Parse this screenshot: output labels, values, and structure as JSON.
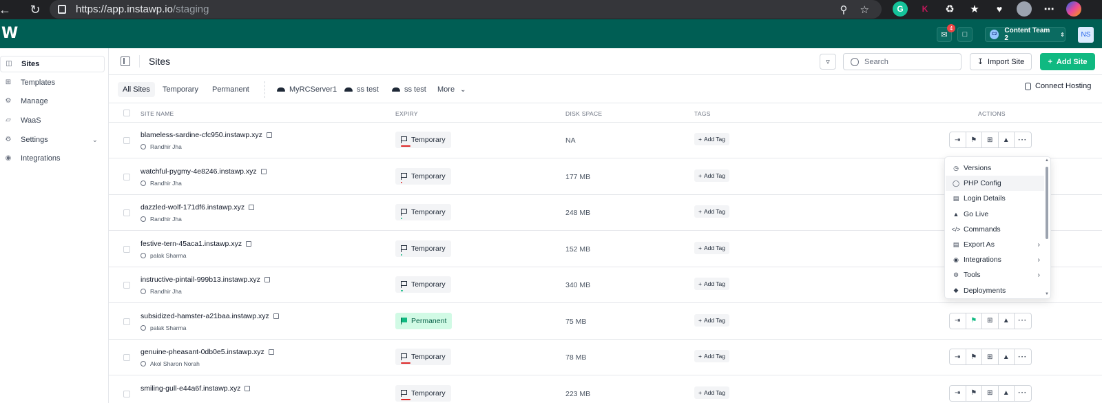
{
  "browser": {
    "url_host": "https://app.instawp.io",
    "url_path": "/staging",
    "extensions": [
      "G",
      "K"
    ]
  },
  "header": {
    "logo": "W",
    "notification_count": "4",
    "team_initials": "C2",
    "team_name": "Content Team 2",
    "user_initials": "NS"
  },
  "sidebar": {
    "items": [
      {
        "label": "Sites",
        "icon": "sites-icon"
      },
      {
        "label": "Templates",
        "icon": "templates-icon"
      },
      {
        "label": "Manage",
        "icon": "manage-icon"
      },
      {
        "label": "WaaS",
        "icon": "waas-icon"
      },
      {
        "label": "Settings",
        "icon": "settings-icon"
      },
      {
        "label": "Integrations",
        "icon": "integrations-icon"
      }
    ]
  },
  "page": {
    "title": "Sites",
    "search_placeholder": "Search",
    "import_label": "Import Site",
    "add_label": "Add Site"
  },
  "tabs": {
    "all": "All Sites",
    "temporary": "Temporary",
    "permanent": "Permanent",
    "servers": [
      "MyRCServer1",
      "ss test",
      "ss test"
    ],
    "more": "More",
    "connect_hosting": "Connect Hosting"
  },
  "table": {
    "headers": {
      "site_name": "SITE NAME",
      "expiry": "EXPIRY",
      "disk": "DISK SPACE",
      "tags": "TAGS",
      "actions": "ACTIONS"
    },
    "add_tag_label": "Add Tag",
    "rows": [
      {
        "name": "blameless-sardine-cfc950.instawp.xyz",
        "owner": "Randhir Jha",
        "expiry": "Temporary",
        "expiry_progress": 0.92,
        "expiry_color": "#dc2626",
        "disk": "NA"
      },
      {
        "name": "watchful-pygmy-4e8246.instawp.xyz",
        "owner": "Randhir Jha",
        "expiry": "Temporary",
        "expiry_progress": 0.02,
        "expiry_color": "#dc2626",
        "disk": "177 MB"
      },
      {
        "name": "dazzled-wolf-171df6.instawp.xyz",
        "owner": "Randhir Jha",
        "expiry": "Temporary",
        "expiry_progress": 0.03,
        "expiry_color": "#10b981",
        "disk": "248 MB"
      },
      {
        "name": "festive-tern-45aca1.instawp.xyz",
        "owner": "palak Sharma",
        "expiry": "Temporary",
        "expiry_progress": 0.12,
        "expiry_color": "#10b981",
        "disk": "152 MB"
      },
      {
        "name": "instructive-pintail-999b13.instawp.xyz",
        "owner": "Randhir Jha",
        "expiry": "Temporary",
        "expiry_progress": 0.22,
        "expiry_color": "#10b981",
        "disk": "340 MB"
      },
      {
        "name": "subsidized-hamster-a21baa.instawp.xyz",
        "owner": "palak Sharma",
        "expiry": "Permanent",
        "expiry_progress": 0,
        "expiry_color": "#10b981",
        "disk": "75 MB"
      },
      {
        "name": "genuine-pheasant-0db0e5.instawp.xyz",
        "owner": "Akol Sharon Norah",
        "expiry": "Temporary",
        "expiry_progress": 0.92,
        "expiry_color": "#dc2626",
        "disk": "78 MB"
      },
      {
        "name": "smiling-gull-e44a6f.instawp.xyz",
        "owner": "",
        "expiry": "Temporary",
        "expiry_progress": 0.92,
        "expiry_color": "#dc2626",
        "disk": "223 MB"
      }
    ]
  },
  "action_menu": {
    "items": [
      {
        "label": "Versions",
        "icon": "clock-icon",
        "submenu": false
      },
      {
        "label": "PHP Config",
        "icon": "php-icon",
        "submenu": false
      },
      {
        "label": "Login Details",
        "icon": "document-icon",
        "submenu": false
      },
      {
        "label": "Go Live",
        "icon": "rocket-icon",
        "submenu": false
      },
      {
        "label": "Commands",
        "icon": "code-icon",
        "submenu": false
      },
      {
        "label": "Export As",
        "icon": "export-icon",
        "submenu": true
      },
      {
        "label": "Integrations",
        "icon": "integrations-icon",
        "submenu": true
      },
      {
        "label": "Tools",
        "icon": "tools-icon",
        "submenu": true
      },
      {
        "label": "Deployments",
        "icon": "deploy-icon",
        "submenu": false
      }
    ]
  },
  "colors": {
    "brand": "#005e54",
    "accent": "#10b981",
    "danger": "#dc2626"
  }
}
